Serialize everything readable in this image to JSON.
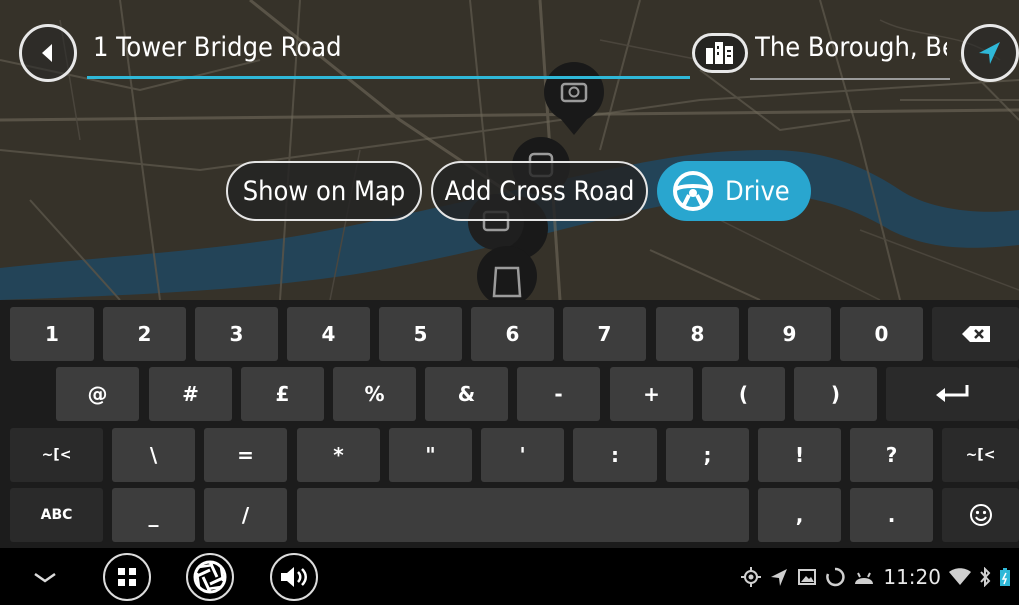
{
  "search": {
    "query": "1 Tower Bridge Road",
    "area": "The Borough, Ber",
    "area_icon": "city-icon",
    "back_icon": "back-arrow-icon",
    "nav_icon": "navigation-arrow-icon"
  },
  "actions": {
    "show_on_map": "Show on Map",
    "add_cross_road": "Add Cross Road",
    "drive": "Drive",
    "drive_icon": "steering-wheel-icon"
  },
  "keyboard": {
    "row1": [
      "1",
      "2",
      "3",
      "4",
      "5",
      "6",
      "7",
      "8",
      "9",
      "0"
    ],
    "row2": [
      "@",
      "#",
      "£",
      "%",
      "&",
      "-",
      "+",
      "(",
      ")"
    ],
    "row3": [
      "~[<",
      "\\",
      "=",
      "*",
      "\"",
      "'",
      ":",
      ";",
      "!",
      "?",
      "~[<"
    ],
    "row4_abc": "ABC",
    "row4_keys": [
      "_",
      "/"
    ],
    "row4_right": [
      ",",
      "."
    ],
    "backspace_icon": "backspace-icon",
    "enter_icon": "enter-arrow-icon",
    "emoji_icon": "smiley-icon"
  },
  "navbar": {
    "time": "11:20",
    "icons": [
      "chevron-down-icon",
      "grid-menu-icon",
      "shutter-icon",
      "volume-icon"
    ],
    "status_icons": [
      "gps-icon",
      "nav-status-icon",
      "image-icon",
      "sync-icon",
      "android-icon",
      "wifi-icon",
      "bluetooth-icon",
      "battery-icon"
    ]
  },
  "colors": {
    "accent": "#29a6cf",
    "underline": "#2fb8d8",
    "map_base": "#4a4233",
    "river": "#2a5470"
  }
}
